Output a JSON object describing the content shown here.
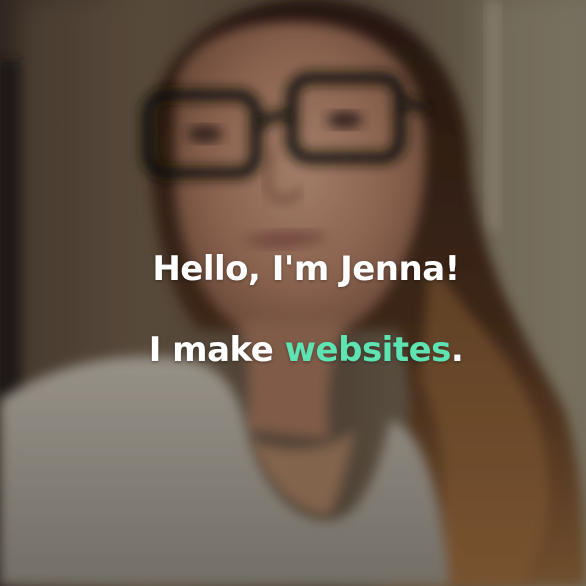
{
  "hero": {
    "greeting": "Hello, I'm Jenna!",
    "tagline_prefix": "I make ",
    "tagline_highlight": "websites",
    "tagline_suffix": ".",
    "accent_color": "#5ee3b2",
    "text_color": "#ffffff"
  }
}
